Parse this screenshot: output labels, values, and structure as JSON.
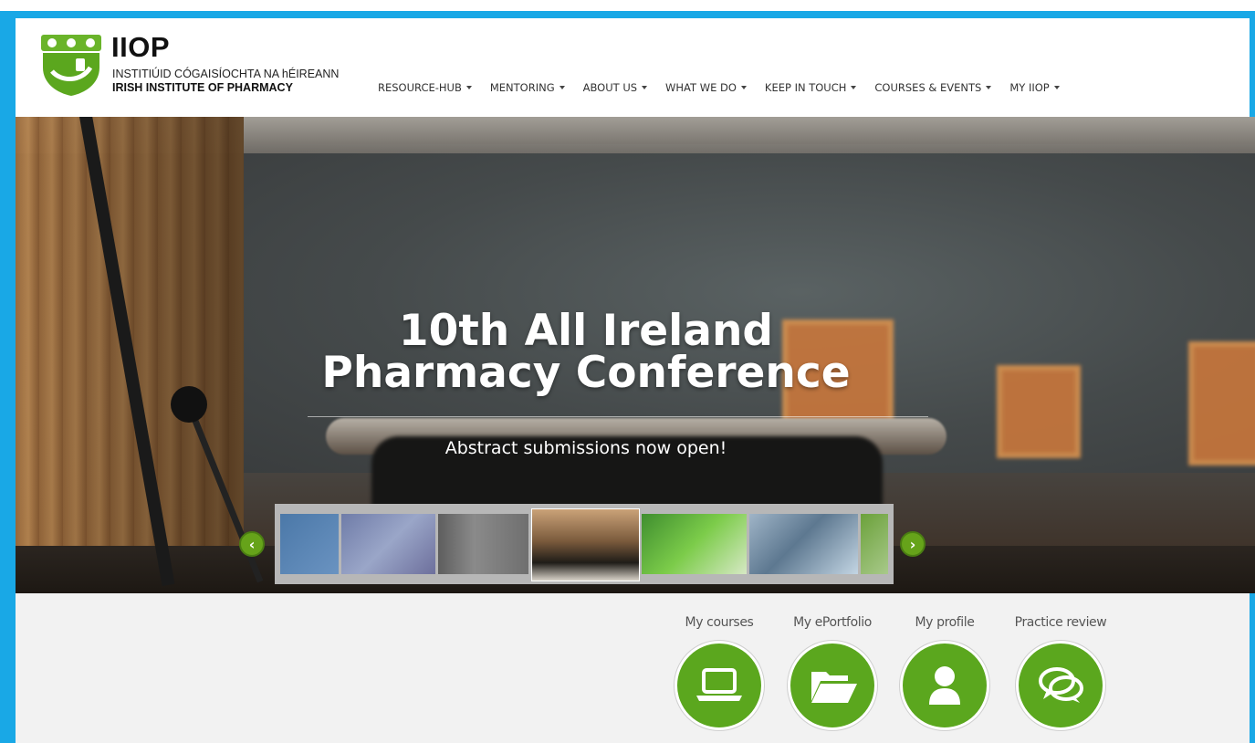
{
  "brand": {
    "title": "IIOP",
    "subtitle_irish": "INSTITIÚID CÓGAISÍOCHTA NA hÉIREANN",
    "subtitle_english": "IRISH INSTITUTE OF PHARMACY",
    "colors": {
      "primary_green": "#5ba71e",
      "frame_blue": "#19a8e6"
    }
  },
  "nav": {
    "items": [
      {
        "label": "RESOURCE-HUB"
      },
      {
        "label": "MENTORING"
      },
      {
        "label": "ABOUT US"
      },
      {
        "label": "WHAT WE DO"
      },
      {
        "label": "KEEP IN TOUCH"
      },
      {
        "label": "COURSES & EVENTS"
      },
      {
        "label": "MY IIOP"
      }
    ]
  },
  "hero": {
    "title": "10th All Ireland\nPharmacy Conference",
    "subtitle": "Abstract submissions now open!",
    "prev_icon": "chevron-left-icon",
    "next_icon": "chevron-right-icon"
  },
  "quick_links": [
    {
      "label": "My courses",
      "icon": "laptop-icon"
    },
    {
      "label": "My ePortfolio",
      "icon": "folder-open-icon"
    },
    {
      "label": "My profile",
      "icon": "user-icon"
    },
    {
      "label": "Practice review",
      "icon": "chat-bubbles-icon"
    }
  ]
}
